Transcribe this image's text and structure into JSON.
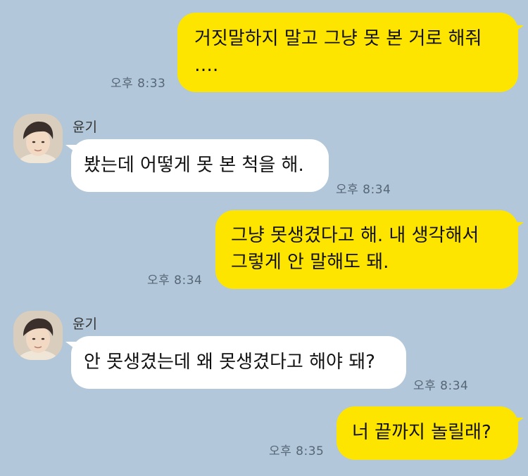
{
  "messages": [
    {
      "from": "me",
      "text": "거짓말하지 말고 그냥 못 본 거로 해줘\n….",
      "time": "오후 8:33"
    },
    {
      "from": "other",
      "sender": "윤기",
      "text": "봤는데 어떻게 못 본 척을 해.",
      "time": "오후 8:34"
    },
    {
      "from": "me",
      "text": "그냥 못생겼다고 해. 내 생각해서\n그렇게 안 말해도 돼.",
      "time": "오후 8:34"
    },
    {
      "from": "other",
      "sender": "윤기",
      "text": "안 못생겼는데 왜 못생겼다고 해야 돼?",
      "time": "오후 8:34"
    },
    {
      "from": "me",
      "text": "너 끝까지 놀릴래?",
      "time": "오후 8:35"
    }
  ],
  "colors": {
    "background": "#b2c7d9",
    "my_bubble": "#fee500",
    "their_bubble": "#ffffff"
  },
  "icons": {
    "avatar": "profile-photo"
  }
}
